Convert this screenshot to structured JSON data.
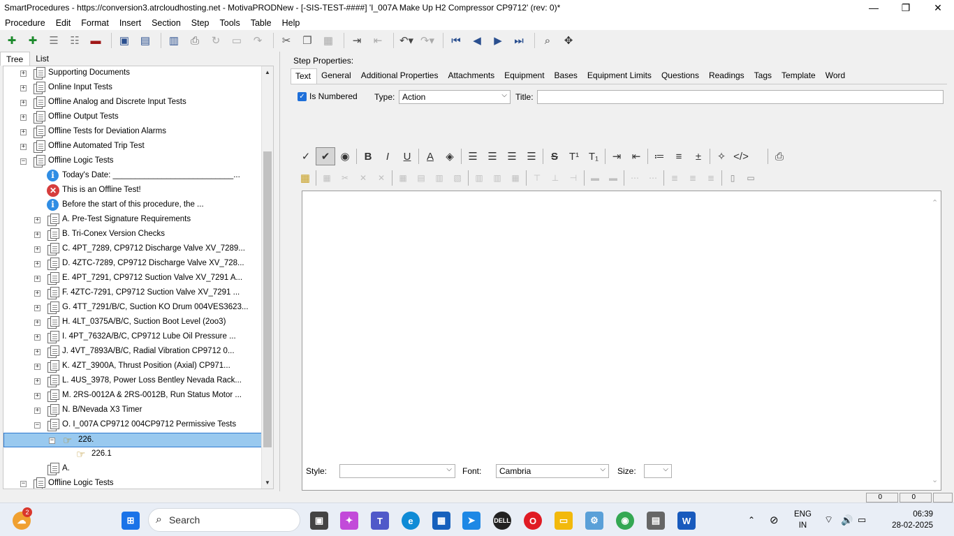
{
  "window": {
    "title": "SmartProcedures - https://conversion3.atrcloudhosting.net - MotivaPRODNew - [-SIS-TEST-####] 'I_007A Make Up H2 Compressor CP9712' (rev: 0)*",
    "minimize": "—",
    "maximize": "❐",
    "close": "✕"
  },
  "menu": [
    "Procedure",
    "Edit",
    "Format",
    "Insert",
    "Section",
    "Step",
    "Tools",
    "Table",
    "Help"
  ],
  "left_tabs": [
    "Tree",
    "List"
  ],
  "tree": [
    {
      "label": "Supporting Documents",
      "icon": "document-icon",
      "expander": "+",
      "level": 0
    },
    {
      "label": "Online Input Tests",
      "icon": "document-icon",
      "expander": "+",
      "level": 0
    },
    {
      "label": "Offline Analog and Discrete Input Tests",
      "icon": "document-icon",
      "expander": "+",
      "level": 0
    },
    {
      "label": "Offline Output Tests",
      "icon": "document-icon",
      "expander": "+",
      "level": 0
    },
    {
      "label": "Offline Tests for Deviation Alarms",
      "icon": "document-icon",
      "expander": "+",
      "level": 0
    },
    {
      "label": "Offline Automated Trip Test",
      "icon": "document-icon",
      "expander": "+",
      "level": 0
    },
    {
      "label": "Offline Logic Tests",
      "icon": "document-icon",
      "expander": "−",
      "level": 0
    },
    {
      "label": "Today's Date: ___________________________...",
      "icon": "info-icon",
      "expander": "",
      "level": 1
    },
    {
      "label": "This is an Offline Test!",
      "icon": "error-icon",
      "expander": "",
      "level": 1
    },
    {
      "label": "Before the start of this procedure, the ...",
      "icon": "info-icon",
      "expander": "",
      "level": 1
    },
    {
      "label": "A. Pre-Test Signature Requirements",
      "icon": "document-icon",
      "expander": "+",
      "level": 1
    },
    {
      "label": "B. Tri-Conex Version Checks",
      "icon": "document-icon",
      "expander": "+",
      "level": 1
    },
    {
      "label": "C. 4PT_7289, CP9712 Discharge Valve XV_7289...",
      "icon": "document-icon",
      "expander": "+",
      "level": 1
    },
    {
      "label": "D. 4ZTC-7289, CP9712 Discharge Valve XV_728...",
      "icon": "document-icon",
      "expander": "+",
      "level": 1
    },
    {
      "label": "E. 4PT_7291, CP9712 Suction Valve XV_7291 A...",
      "icon": "document-icon",
      "expander": "+",
      "level": 1
    },
    {
      "label": "F. 4ZTC-7291, CP9712 Suction Valve XV_7291 ...",
      "icon": "document-icon",
      "expander": "+",
      "level": 1
    },
    {
      "label": "G. 4TT_7291/B/C, Suction KO Drum 004VES3623...",
      "icon": "document-icon",
      "expander": "+",
      "level": 1
    },
    {
      "label": "H. 4LT_0375A/B/C, Suction Boot Level (2oo3)",
      "icon": "document-icon",
      "expander": "+",
      "level": 1
    },
    {
      "label": "I. 4PT_7632A/B/C, CP9712 Lube Oil Pressure ...",
      "icon": "document-icon",
      "expander": "+",
      "level": 1
    },
    {
      "label": "J. 4VT_7893A/B/C, Radial Vibration CP9712 0...",
      "icon": "document-icon",
      "expander": "+",
      "level": 1
    },
    {
      "label": "K. 4ZT_3900A, Thrust Position (Axial) CP971...",
      "icon": "document-icon",
      "expander": "+",
      "level": 1
    },
    {
      "label": "L. 4US_3978, Power Loss Bentley Nevada Rack...",
      "icon": "document-icon",
      "expander": "+",
      "level": 1
    },
    {
      "label": "M. 2RS-0012A & 2RS-0012B, Run Status Motor ...",
      "icon": "document-icon",
      "expander": "+",
      "level": 1
    },
    {
      "label": "N. B/Nevada X3 Timer",
      "icon": "document-icon",
      "expander": "+",
      "level": 1
    },
    {
      "label": "O. I_007A CP9712 004CP9712 Permissive Tests",
      "icon": "document-icon",
      "expander": "−",
      "level": 1
    },
    {
      "label": "226.",
      "icon": "hand-icon",
      "expander": "−",
      "level": 2,
      "selected": true
    },
    {
      "label": "226.1",
      "icon": "hand-icon",
      "expander": "",
      "level": 3
    },
    {
      "label": "A.",
      "icon": "document-icon",
      "expander": "",
      "level": 0.5
    },
    {
      "label": "Offline Logic Tests",
      "icon": "document-icon",
      "expander": "−",
      "level": 0
    }
  ],
  "right": {
    "step_properties_label": "Step Properties:",
    "tabs": [
      "Text",
      "General",
      "Additional Properties",
      "Attachments",
      "Equipment",
      "Bases",
      "Equipment Limits",
      "Questions",
      "Readings",
      "Tags",
      "Template",
      "Word"
    ],
    "is_numbered_label": "Is Numbered",
    "is_numbered_checked": true,
    "type_label": "Type:",
    "type_value": "Action",
    "title_label": "Title:",
    "title_value": "",
    "style_label": "Style:",
    "style_value": "",
    "font_label": "Font:",
    "font_value": "Cambria",
    "size_label": "Size:",
    "size_value": ""
  },
  "status": {
    "cell1": "0",
    "cell2": "0"
  },
  "taskbar": {
    "search_placeholder": "Search",
    "notification_count": "2",
    "language_line1": "ENG",
    "language_line2": "IN",
    "time": "06:39",
    "date": "28-02-2025"
  }
}
